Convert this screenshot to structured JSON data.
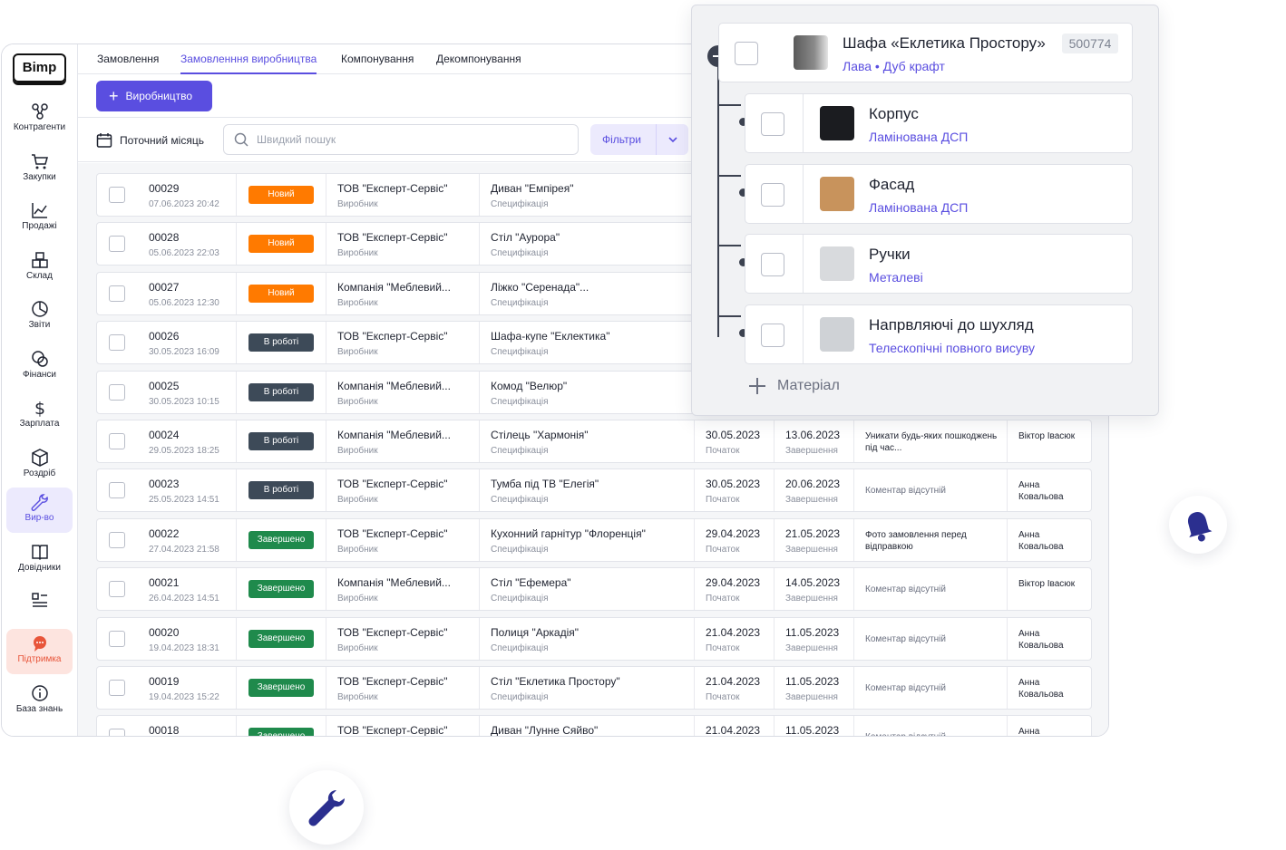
{
  "app": {
    "logo": "Bimp",
    "sidebar": [
      {
        "label": "Контрагенти",
        "icon": "contractors-icon"
      },
      {
        "label": "Закупки",
        "icon": "cart-icon"
      },
      {
        "label": "Продажі",
        "icon": "sales-chart-icon"
      },
      {
        "label": "Склад",
        "icon": "warehouse-icon"
      },
      {
        "label": "Звіти",
        "icon": "reports-pie-icon"
      },
      {
        "label": "Фінанси",
        "icon": "finance-coins-icon"
      },
      {
        "label": "Зарплата",
        "icon": "dollar-icon"
      },
      {
        "label": "Роздріб",
        "icon": "retail-box-icon"
      },
      {
        "label": "Вир-во",
        "icon": "wrench-icon"
      },
      {
        "label": "Довідники",
        "icon": "book-icon"
      },
      {
        "label": "",
        "icon": "grid-list-icon"
      },
      {
        "label": "Підтримка",
        "icon": "support-chat-icon"
      },
      {
        "label": "База знань",
        "icon": "info-icon"
      }
    ],
    "tabs": [
      "Замовлення",
      "Замовленння виробництва",
      "Компонування",
      "Декомпонування"
    ],
    "active_tab": "Замовленння виробництва",
    "primary_button": "Виробництво",
    "period": "Поточний місяць",
    "search_placeholder": "Швидкий пошук",
    "filters_label": "Фільтри"
  },
  "rows": [
    {
      "num": "00029",
      "dt": "07.06.2023 20:42",
      "status": "Новий",
      "st": "new",
      "org": "ТОВ \"Експерт-Сервіс\"",
      "role": "Виробник",
      "item": "Диван \"Емпірея\"",
      "spec": "Специфікація",
      "start": "",
      "start_l": "",
      "end": "",
      "end_l": "",
      "comment": "",
      "person": ""
    },
    {
      "num": "00028",
      "dt": "05.06.2023 22:03",
      "status": "Новий",
      "st": "new",
      "org": "ТОВ \"Експерт-Сервіс\"",
      "role": "Виробник",
      "item": "Стіл \"Аурора\"",
      "spec": "Специфікація",
      "start": "",
      "start_l": "",
      "end": "",
      "end_l": "",
      "comment": "",
      "person": ""
    },
    {
      "num": "00027",
      "dt": "05.06.2023 12:30",
      "status": "Новий",
      "st": "new",
      "org": "Компанія \"Меблевий...",
      "role": "Виробник",
      "item": "Ліжко \"Серенада\"...",
      "spec": "Специфікація",
      "start": "",
      "start_l": "",
      "end": "",
      "end_l": "",
      "comment": "",
      "person": ""
    },
    {
      "num": "00026",
      "dt": "30.05.2023 16:09",
      "status": "В роботі",
      "st": "work",
      "org": "ТОВ \"Експерт-Сервіс\"",
      "role": "Виробник",
      "item": "Шафа-купе \"Еклектика\"",
      "spec": "Специфікація",
      "start": "",
      "start_l": "",
      "end": "",
      "end_l": "",
      "comment": "",
      "person": ""
    },
    {
      "num": "00025",
      "dt": "30.05.2023 10:15",
      "status": "В роботі",
      "st": "work",
      "org": "Компанія \"Меблевий...",
      "role": "Виробник",
      "item": "Комод \"Велюр\"",
      "spec": "Специфікація",
      "start": "",
      "start_l": "",
      "end": "",
      "end_l": "",
      "comment": "",
      "person": ""
    },
    {
      "num": "00024",
      "dt": "29.05.2023 18:25",
      "status": "В роботі",
      "st": "work",
      "org": "Компанія \"Меблевий...",
      "role": "Виробник",
      "item": "Стілець \"Хармонія\"",
      "spec": "Специфікація",
      "start": "30.05.2023",
      "start_l": "Початок",
      "end": "13.06.2023",
      "end_l": "Завершення",
      "comment": "Уникати будь-яких пошкоджень під час...",
      "person": "Віктор Івасюк"
    },
    {
      "num": "00023",
      "dt": "25.05.2023 14:51",
      "status": "В роботі",
      "st": "work",
      "org": "ТОВ \"Експерт-Сервіс\"",
      "role": "Виробник",
      "item": "Тумба під ТВ \"Елегія\"",
      "spec": "Специфікація",
      "start": "30.05.2023",
      "start_l": "Початок",
      "end": "20.06.2023",
      "end_l": "Завершення",
      "comment": "Коментар відсутній",
      "person": "Анна Ковальова"
    },
    {
      "num": "00022",
      "dt": "27.04.2023 21:58",
      "status": "Завершено",
      "st": "done",
      "org": "ТОВ \"Експерт-Сервіс\"",
      "role": "Виробник",
      "item": "Кухонний гарнітур \"Флоренція\"",
      "spec": "Специфікація",
      "start": "29.04.2023",
      "start_l": "Початок",
      "end": "21.05.2023",
      "end_l": "Завершення",
      "comment": "Фото замовлення перед відправкою",
      "person": "Анна Ковальова"
    },
    {
      "num": "00021",
      "dt": "26.04.2023 14:51",
      "status": "Завершено",
      "st": "done",
      "org": "Компанія \"Меблевий...",
      "role": "Виробник",
      "item": "Стіл \"Ефемера\"",
      "spec": "Специфікація",
      "start": "29.04.2023",
      "start_l": "Початок",
      "end": "14.05.2023",
      "end_l": "Завершення",
      "comment": "Коментар відсутній",
      "person": "Віктор Івасюк"
    },
    {
      "num": "00020",
      "dt": "19.04.2023 18:31",
      "status": "Завершено",
      "st": "done",
      "org": "ТОВ \"Експерт-Сервіс\"",
      "role": "Виробник",
      "item": "Полиця \"Аркадія\"",
      "spec": "Специфікація",
      "start": "21.04.2023",
      "start_l": "Початок",
      "end": "11.05.2023",
      "end_l": "Завершення",
      "comment": "Коментар відсутній",
      "person": "Анна Ковальова"
    },
    {
      "num": "00019",
      "dt": "19.04.2023 15:22",
      "status": "Завершено",
      "st": "done",
      "org": "ТОВ \"Експерт-Сервіс\"",
      "role": "Виробник",
      "item": "Стіл \"Еклетика Простору\"",
      "spec": "Специфікація",
      "start": "21.04.2023",
      "start_l": "Початок",
      "end": "11.05.2023",
      "end_l": "Завершення",
      "comment": "Коментар відсутній",
      "person": "Анна Ковальова"
    },
    {
      "num": "00018",
      "dt": "",
      "status": "Завершено",
      "st": "done",
      "org": "ТОВ \"Експерт-Сервіс\"",
      "role": "",
      "item": "Диван \"Лунне Сяйво\"",
      "spec": "",
      "start": "21.04.2023",
      "start_l": "",
      "end": "11.05.2023",
      "end_l": "",
      "comment": "Коментар відсутній",
      "person": "Анна"
    }
  ],
  "popup": {
    "root": {
      "name": "Шафа «Еклетика Простору»",
      "sub": "Лава • Дуб крафт",
      "code": "500774"
    },
    "children": [
      {
        "name": "Корпус",
        "sub": "Ламінована ДСП",
        "thumb": "#1b1c20"
      },
      {
        "name": "Фасад",
        "sub": "Ламінована ДСП",
        "thumb": "#c8935c"
      },
      {
        "name": "Ручки",
        "sub": "Металеві",
        "thumb": "#d8dadd"
      },
      {
        "name": "Напрвляючі до шухляд",
        "sub": "Телескопічні повного висуву",
        "thumb": "#cfd2d6"
      }
    ],
    "add_label": "Матеріал"
  },
  "colors": {
    "accent": "#5a4ee0",
    "new": "#ff7a00",
    "work": "#3d4a58",
    "done": "#1f8a4c",
    "float_icon": "#2b2f8f"
  }
}
